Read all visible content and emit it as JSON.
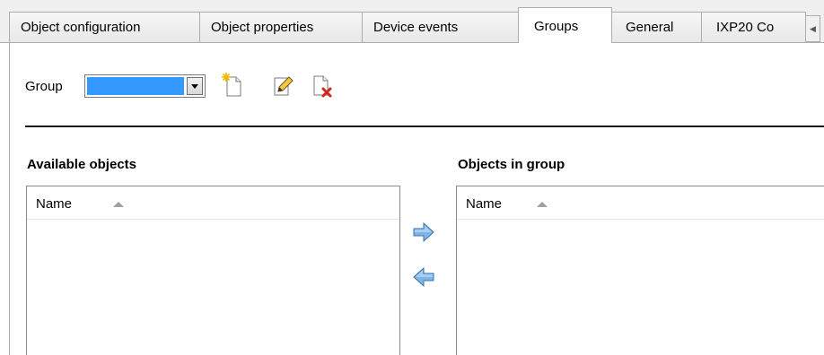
{
  "tabs": [
    {
      "label": "Object configuration",
      "active": false
    },
    {
      "label": "Object properties",
      "active": false
    },
    {
      "label": "Device events",
      "active": false
    },
    {
      "label": "Groups",
      "active": true
    },
    {
      "label": "General",
      "active": false
    },
    {
      "label": "IXP20 Co",
      "active": false
    }
  ],
  "tab_scroll_icon": "scroll-left-icon",
  "group": {
    "label": "Group",
    "selected_value": "",
    "toolbar_icons": [
      "new-group-icon",
      "edit-group-icon",
      "delete-group-icon"
    ]
  },
  "available": {
    "title": "Available objects",
    "column": "Name",
    "rows": []
  },
  "in_group": {
    "title": "Objects in group",
    "column": "Name",
    "rows": []
  },
  "move_icons": [
    "arrow-right-icon",
    "arrow-left-icon"
  ],
  "colors": {
    "selection": "#3399ff",
    "arrow_fill": "#5b9bd5",
    "delete_red": "#d0261e"
  }
}
